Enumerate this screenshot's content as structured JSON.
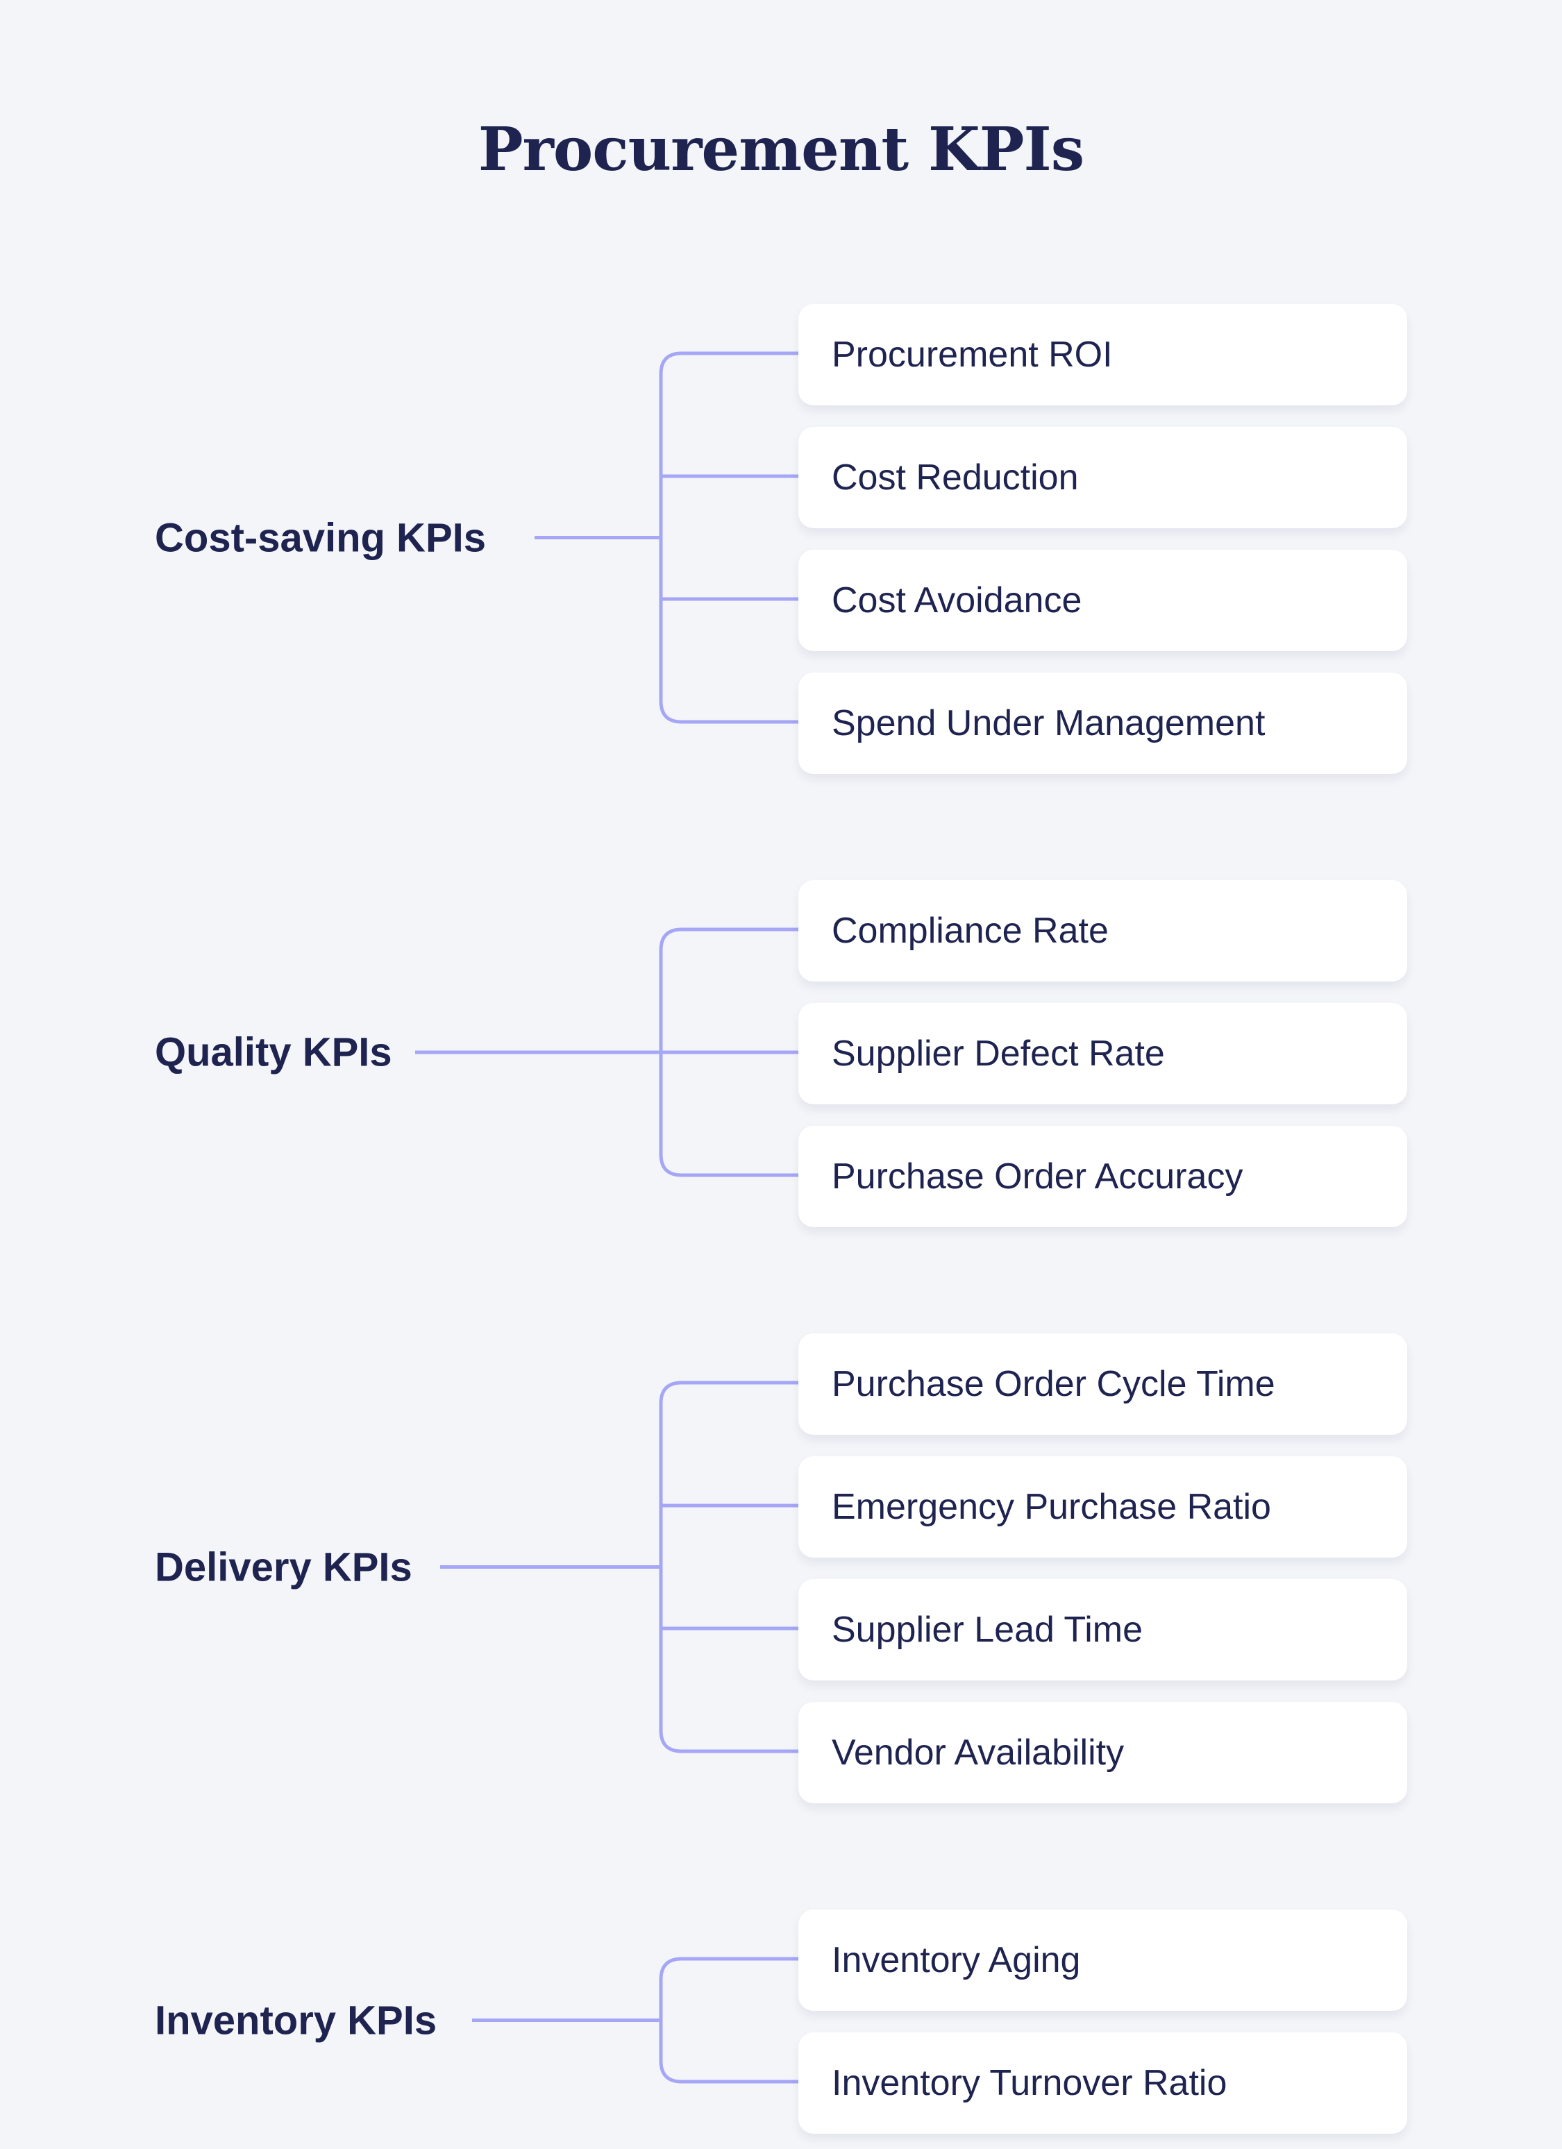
{
  "title": "Procurement KPIs",
  "colors": {
    "background": "#f4f5f9",
    "text": "#1e2350",
    "connector": "#a5a6f6",
    "card": "#ffffff"
  },
  "groups": [
    {
      "label": "Cost-saving KPIs",
      "items": [
        "Procurement ROI",
        "Cost Reduction",
        "Cost Avoidance",
        "Spend Under Management"
      ]
    },
    {
      "label": "Quality KPIs",
      "items": [
        "Compliance Rate",
        "Supplier Defect Rate",
        "Purchase Order Accuracy"
      ]
    },
    {
      "label": "Delivery KPIs",
      "items": [
        "Purchase Order Cycle Time",
        "Emergency Purchase Ratio",
        "Supplier Lead Time",
        "Vendor Availability"
      ]
    },
    {
      "label": "Inventory KPIs",
      "items": [
        "Inventory Aging",
        "Inventory Turnover Ratio"
      ]
    }
  ]
}
